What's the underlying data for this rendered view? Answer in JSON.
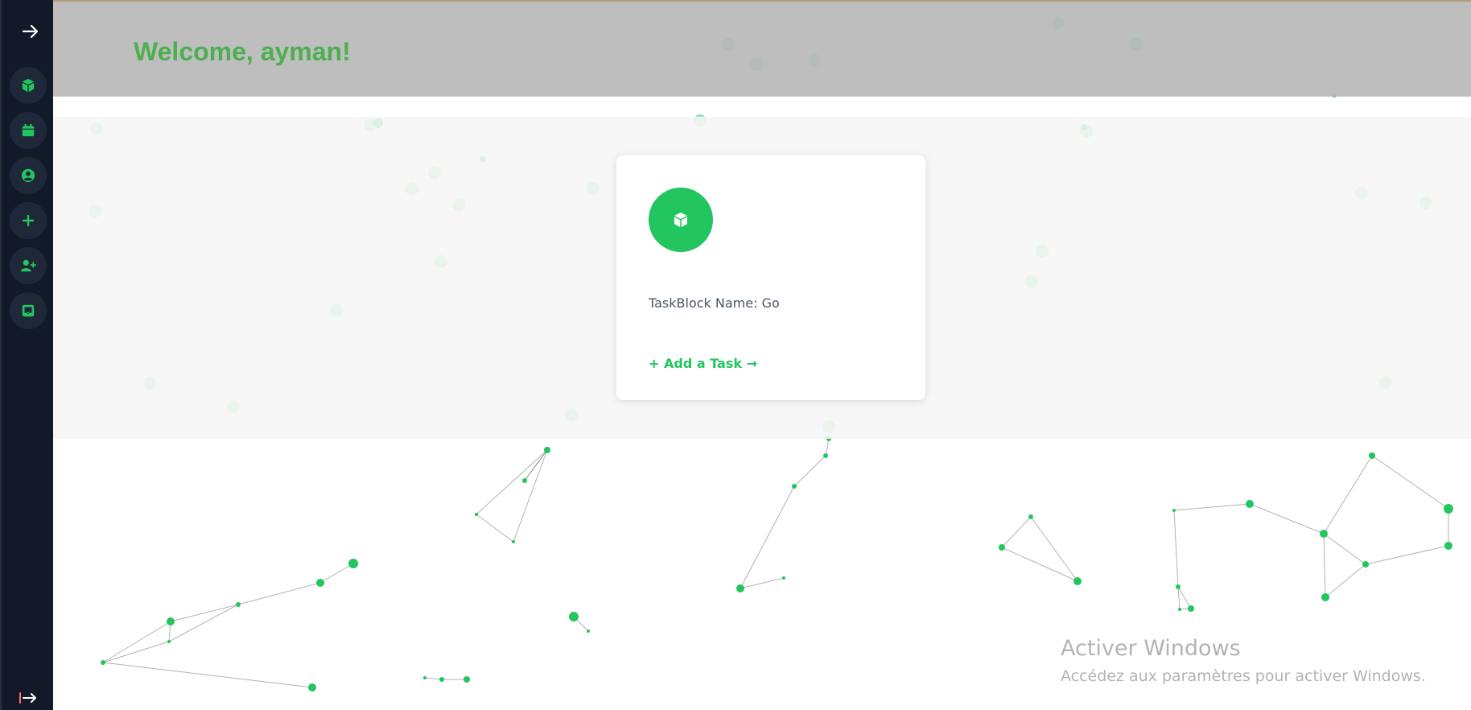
{
  "app": {
    "welcome_text": "Welcome, ayman!",
    "accent_color": "#22c55e",
    "header_text_color": "#4caf50",
    "sidebar_color": "#121a2a"
  },
  "sidebar": {
    "toggle_icon": "arrow-right-icon",
    "items": [
      {
        "icon": "cube-icon"
      },
      {
        "icon": "calendar-icon"
      },
      {
        "icon": "user-circle-icon"
      },
      {
        "icon": "plus-icon"
      },
      {
        "icon": "user-plus-icon"
      },
      {
        "icon": "inbox-icon"
      }
    ],
    "logout_icon": "logout-icon"
  },
  "task_block": {
    "icon": "cube-icon",
    "name_label": "TaskBlock Name: Go",
    "add_task_label": "+ Add a Task →"
  },
  "watermark": {
    "title": "Activer Windows",
    "subtitle": "Accédez aux paramètres pour activer Windows."
  }
}
